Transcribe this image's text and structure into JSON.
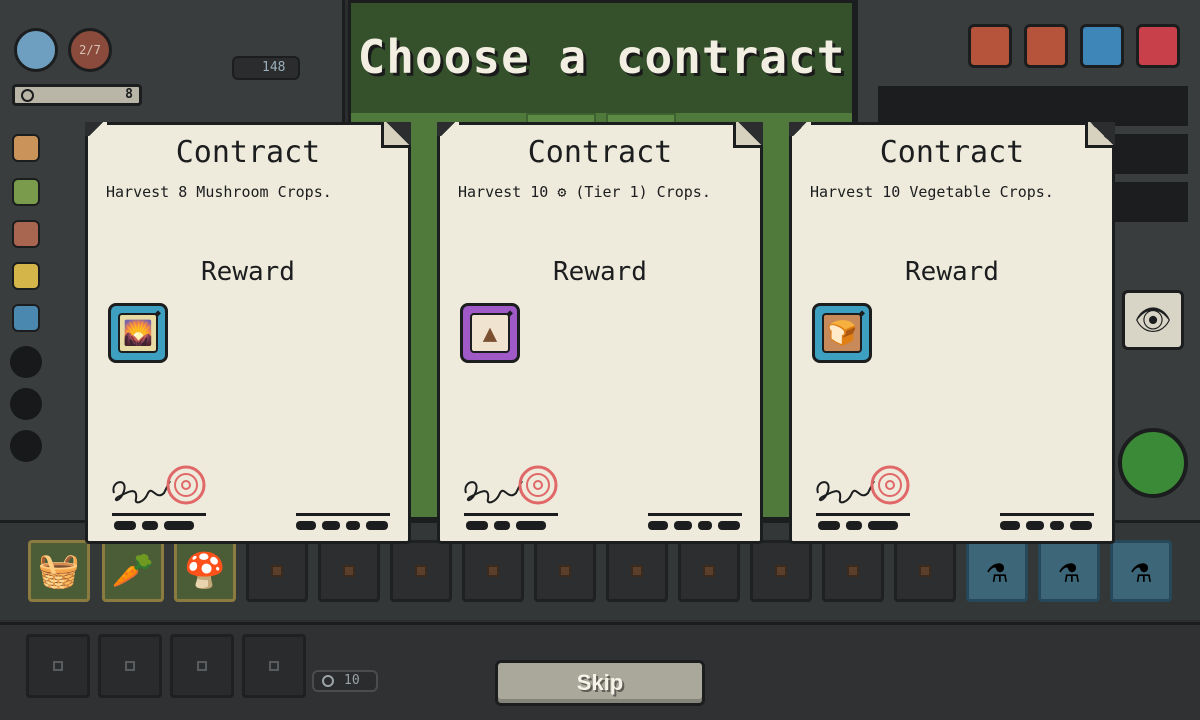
{
  "title": "Choose a contract",
  "hud": {
    "population": "2/7",
    "currency": "148",
    "progress_value": "8",
    "inventory_counter": "10"
  },
  "cards": [
    {
      "title": "Contract",
      "goal": "Harvest 8 Mushroom Crops.",
      "reward_heading": "Reward",
      "reward_icon": "crop-card-icon",
      "reward_color": "#3ea0c0"
    },
    {
      "title": "Contract",
      "goal_prefix": "Harvest 10",
      "goal_suffix": "(Tier 1) Crops.",
      "reward_heading": "Reward",
      "reward_icon": "soil-card-icon",
      "reward_color": "#a05ac8"
    },
    {
      "title": "Contract",
      "goal": "Harvest 10 Vegetable Crops.",
      "reward_heading": "Reward",
      "reward_icon": "bread-icon",
      "reward_color": "#3ea0c0"
    }
  ],
  "skip_label": "Skip"
}
